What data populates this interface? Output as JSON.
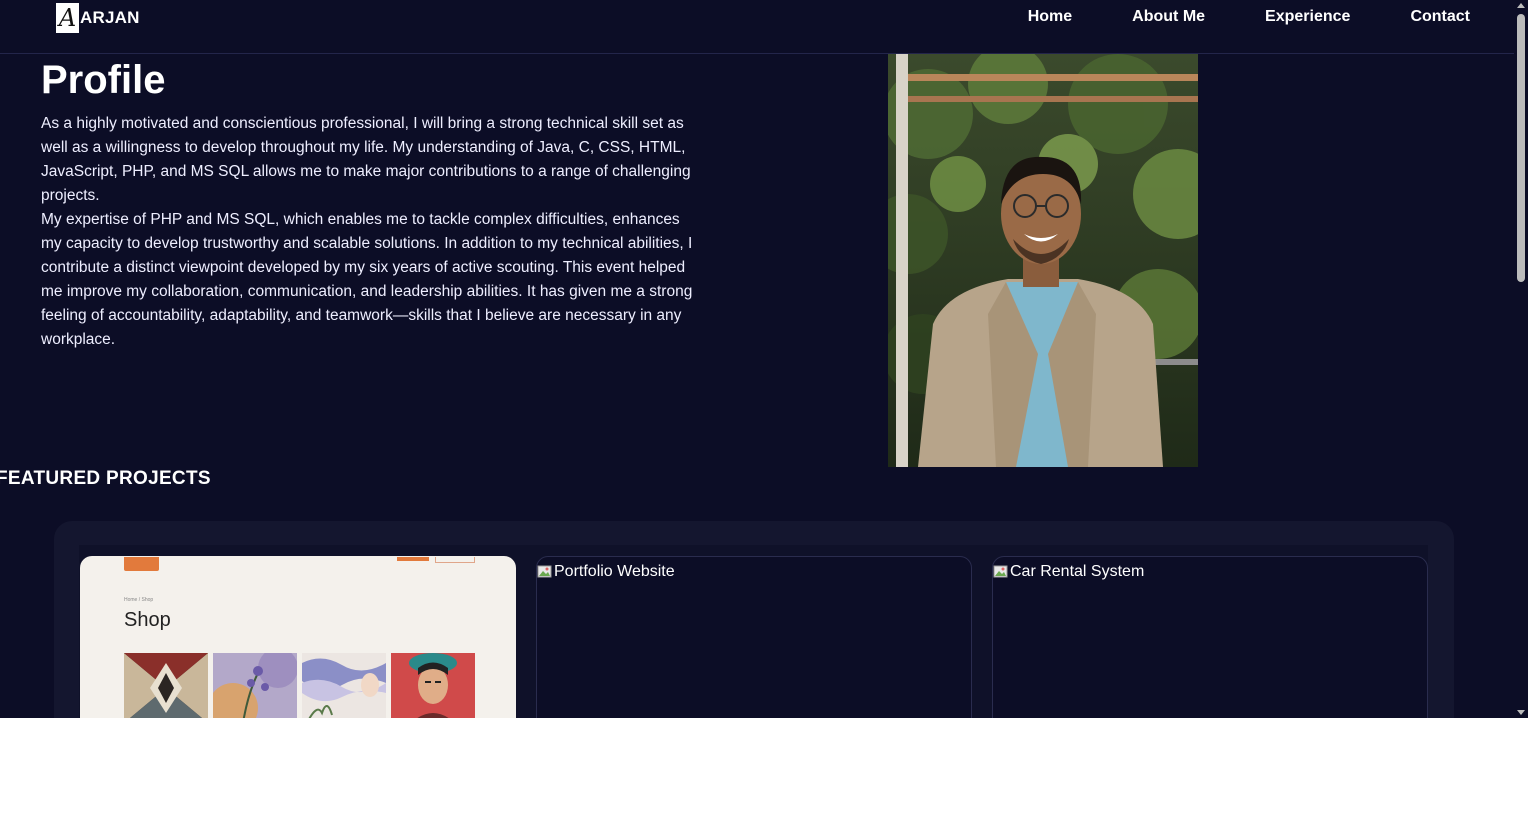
{
  "header": {
    "logo_mark": "A",
    "logo_text": "ARJAN",
    "nav": [
      "Home",
      "About Me",
      "Experience",
      "Contact"
    ]
  },
  "profile": {
    "title": "Profile",
    "paragraph1": "As a highly motivated and conscientious professional, I will bring a strong technical skill set as well as a willingness to develop throughout my life. My understanding of Java, C, CSS, HTML, JavaScript, PHP, and MS SQL allows me to make major contributions to a range of challenging projects.",
    "paragraph2": "My expertise of PHP and MS SQL, which enables me to tackle complex difficulties, enhances my capacity to develop trustworthy and scalable solutions. In addition to my technical abilities, I contribute a distinct viewpoint developed by my six years of active scouting. This event helped me improve my collaboration, communication, and leadership abilities. It has given me a strong feeling of accountability, adaptability, and teamwork—skills that I believe are necessary in any workplace."
  },
  "featured": {
    "title": "FEATURED PROJECTS",
    "projects": [
      {
        "shop_crumb": "Home / Shop",
        "shop_title": "Shop"
      },
      {
        "alt": "Portfolio Website"
      },
      {
        "alt": "Car Rental System"
      }
    ]
  },
  "colors": {
    "background": "#0c0d26",
    "panel": "#14162f",
    "accent": "#e27a3c"
  }
}
